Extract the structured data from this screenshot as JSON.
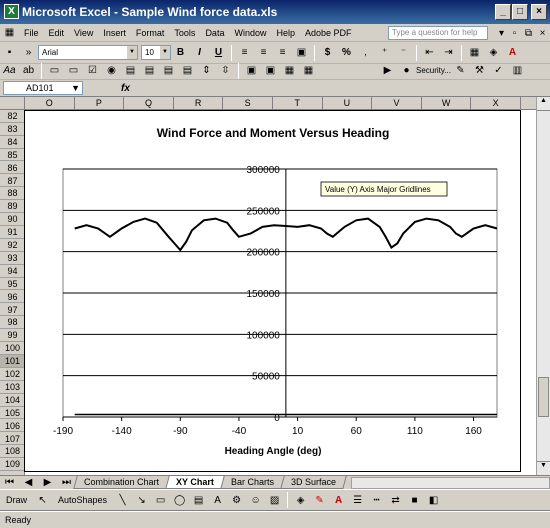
{
  "window": {
    "title": "Microsoft Excel - Sample Wind force data.xls",
    "app_icon": "excel-icon"
  },
  "menu": [
    "File",
    "Edit",
    "View",
    "Insert",
    "Format",
    "Tools",
    "Data",
    "Window",
    "Help",
    "Adobe PDF"
  ],
  "help_placeholder": "Type a question for help",
  "toolbar": {
    "font": "Arial",
    "size": "10",
    "security": "Security..."
  },
  "namebox": "AD101",
  "fx": "fx",
  "columns": [
    "O",
    "P",
    "Q",
    "R",
    "S",
    "T",
    "U",
    "V",
    "W",
    "X"
  ],
  "rows": [
    "82",
    "83",
    "84",
    "85",
    "86",
    "87",
    "88",
    "89",
    "90",
    "91",
    "92",
    "93",
    "94",
    "95",
    "96",
    "97",
    "98",
    "99",
    "100",
    "101",
    "102",
    "103",
    "104",
    "105",
    "106",
    "107",
    "108",
    "109"
  ],
  "tabs": [
    "Combination Chart",
    "XY Chart",
    "Bar Charts",
    "3D Surface"
  ],
  "active_tab": "XY Chart",
  "drawbar": {
    "draw": "Draw",
    "autoshapes": "AutoShapes"
  },
  "status": "Ready",
  "tooltip": "Value (Y) Axis Major Gridlines",
  "chart_data": {
    "type": "line",
    "title": "Wind Force and Moment Versus Heading",
    "xlabel": "Heading Angle (deg)",
    "ylabel": "",
    "xlim": [
      -190,
      180
    ],
    "ylim": [
      0,
      300000
    ],
    "x_ticks": [
      -190,
      -140,
      -90,
      -40,
      10,
      60,
      110,
      160
    ],
    "y_ticks": [
      0,
      50000,
      100000,
      150000,
      200000,
      250000,
      300000
    ],
    "y_tick_labels": [
      "0",
      "50000",
      "100000",
      "150000",
      "200000",
      "250000",
      "300000"
    ],
    "grid": true,
    "series": [
      {
        "color": "#000000",
        "x": [
          -180,
          -170,
          -160,
          -150,
          -140,
          -130,
          -120,
          -110,
          -100,
          -95,
          -90,
          -85,
          -80,
          -70,
          -60,
          -50,
          -45,
          -40,
          -30,
          -20,
          -10,
          0,
          10,
          20,
          30,
          35,
          40,
          50,
          60,
          70,
          80,
          85,
          90,
          95,
          100,
          110,
          120,
          130,
          140,
          145,
          150,
          160,
          170,
          180
        ],
        "y": [
          228000,
          232000,
          228000,
          218000,
          228000,
          236000,
          240000,
          235000,
          218000,
          210000,
          202000,
          212000,
          226000,
          238000,
          240000,
          235000,
          226000,
          218000,
          222000,
          230000,
          232000,
          231000,
          230000,
          232000,
          228000,
          222000,
          218000,
          230000,
          238000,
          240000,
          230000,
          218000,
          205000,
          210000,
          222000,
          236000,
          240000,
          238000,
          230000,
          222000,
          218000,
          228000,
          232000,
          228000
        ]
      },
      {
        "color": "#000000",
        "x": [
          -180,
          180
        ],
        "y": [
          3000,
          3000
        ]
      }
    ]
  }
}
